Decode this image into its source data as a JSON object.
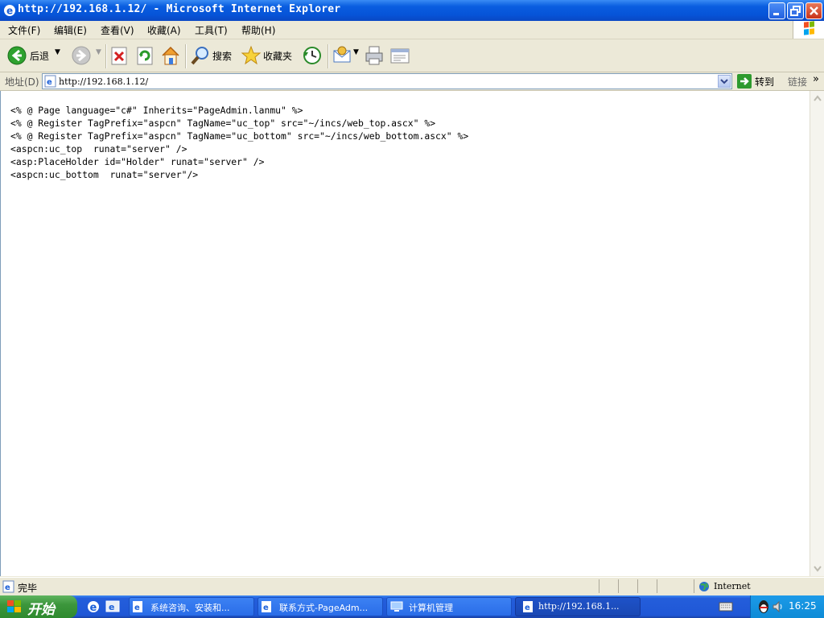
{
  "window": {
    "title": "http://192.168.1.12/ - Microsoft Internet Explorer"
  },
  "menu": [
    "文件(F)",
    "编辑(E)",
    "查看(V)",
    "收藏(A)",
    "工具(T)",
    "帮助(H)"
  ],
  "toolbar": {
    "back_label": "后退",
    "search_label": "搜索",
    "favorites_label": "收藏夹"
  },
  "address": {
    "label": "地址(D)",
    "value": "http://192.168.1.12/",
    "go_label": "转到",
    "links_label": "链接"
  },
  "content": {
    "lines": [
      "<% @ Page language=\"c#\" Inherits=\"PageAdmin.lanmu\" %>",
      "<% @ Register TagPrefix=\"aspcn\" TagName=\"uc_top\" src=\"~/incs/web_top.ascx\" %>",
      "<% @ Register TagPrefix=\"aspcn\" TagName=\"uc_bottom\" src=\"~/incs/web_bottom.ascx\" %>",
      "<aspcn:uc_top  runat=\"server\" />",
      "<asp:PlaceHolder id=\"Holder\" runat=\"server\" />",
      "<aspcn:uc_bottom  runat=\"server\"/>"
    ]
  },
  "status": {
    "text": "完毕",
    "zone": "Internet"
  },
  "taskbar": {
    "start_label": "开始",
    "tasks": [
      "系统咨询、安装和...",
      "联系方式-PageAdm...",
      "计算机管理",
      "http://192.168.1..."
    ],
    "clock": "16:25"
  }
}
